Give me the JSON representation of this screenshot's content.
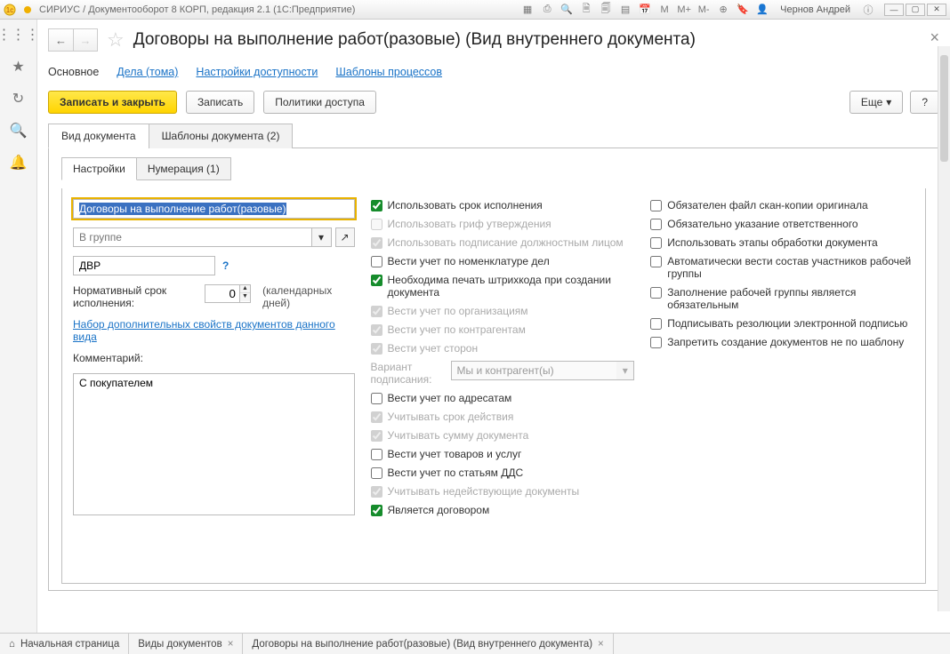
{
  "titlebar": {
    "title": "СИРИУС / Документооборот 8 КОРП, редакция 2.1  (1С:Предприятие)",
    "user": "Чернов Андрей",
    "mbuttons": [
      "M",
      "M+",
      "M-"
    ]
  },
  "page": {
    "title": "Договоры на выполнение работ(разовые) (Вид внутреннего документа)"
  },
  "subnav": {
    "main": "Основное",
    "cases": "Дела (тома)",
    "access": "Настройки доступности",
    "templates": "Шаблоны процессов"
  },
  "toolbar": {
    "save_close": "Записать и закрыть",
    "save": "Записать",
    "policies": "Политики доступа",
    "more": "Еще",
    "help": "?"
  },
  "tabs": {
    "doc_type": "Вид документа",
    "doc_templates": "Шаблоны документа (2)"
  },
  "inner_tabs": {
    "settings": "Настройки",
    "numbering": "Нумерация (1)"
  },
  "form": {
    "name_value": "Договоры на выполнение работ(разовые)",
    "group_placeholder": "В группе",
    "code_value": "ДВР",
    "norm_label": "Нормативный срок исполнения:",
    "norm_value": "0",
    "norm_unit": "(календарных дней)",
    "addprops_link": "Набор дополнительных свойств документов данного вида",
    "comment_label": "Комментарий:",
    "comment_value": "С покупателем",
    "variant_label": "Вариант подписания:",
    "variant_value": "Мы и контрагент(ы)"
  },
  "checks_mid": [
    {
      "label": "Использовать срок исполнения",
      "checked": true,
      "disabled": false
    },
    {
      "label": "Использовать гриф утверждения",
      "checked": false,
      "disabled": true
    },
    {
      "label": "Использовать подписание должностным лицом",
      "checked": true,
      "disabled": true
    },
    {
      "label": "Вести учет по номенклатуре дел",
      "checked": false,
      "disabled": false
    },
    {
      "label": "Необходима печать штрихкода при создании документа",
      "checked": true,
      "disabled": false
    },
    {
      "label": "Вести учет по организациям",
      "checked": true,
      "disabled": true
    },
    {
      "label": "Вести учет по контрагентам",
      "checked": true,
      "disabled": true
    },
    {
      "label": "Вести учет сторон",
      "checked": true,
      "disabled": true
    },
    {
      "label": "Вести учет по адресатам",
      "checked": false,
      "disabled": false
    },
    {
      "label": "Учитывать срок действия",
      "checked": true,
      "disabled": true
    },
    {
      "label": "Учитывать сумму документа",
      "checked": true,
      "disabled": true
    },
    {
      "label": "Вести учет товаров и услуг",
      "checked": false,
      "disabled": false
    },
    {
      "label": "Вести учет по статьям ДДС",
      "checked": false,
      "disabled": false
    },
    {
      "label": "Учитывать недействующие документы",
      "checked": true,
      "disabled": true
    },
    {
      "label": "Является договором",
      "checked": true,
      "disabled": false
    }
  ],
  "checks_right": [
    {
      "label": "Обязателен файл скан-копии оригинала",
      "checked": false,
      "disabled": false
    },
    {
      "label": "Обязательно указание ответственного",
      "checked": false,
      "disabled": false
    },
    {
      "label": "Использовать этапы обработки документа",
      "checked": false,
      "disabled": false
    },
    {
      "label": "Автоматически вести состав участников рабочей группы",
      "checked": false,
      "disabled": false
    },
    {
      "label": "Заполнение рабочей группы является обязательным",
      "checked": false,
      "disabled": false
    },
    {
      "label": "Подписывать резолюции электронной подписью",
      "checked": false,
      "disabled": false
    },
    {
      "label": "Запретить создание документов не по шаблону",
      "checked": false,
      "disabled": false
    }
  ],
  "taskbar": {
    "home": "Начальная страница",
    "t1": "Виды документов",
    "t2": "Договоры на выполнение работ(разовые) (Вид внутреннего документа)"
  }
}
